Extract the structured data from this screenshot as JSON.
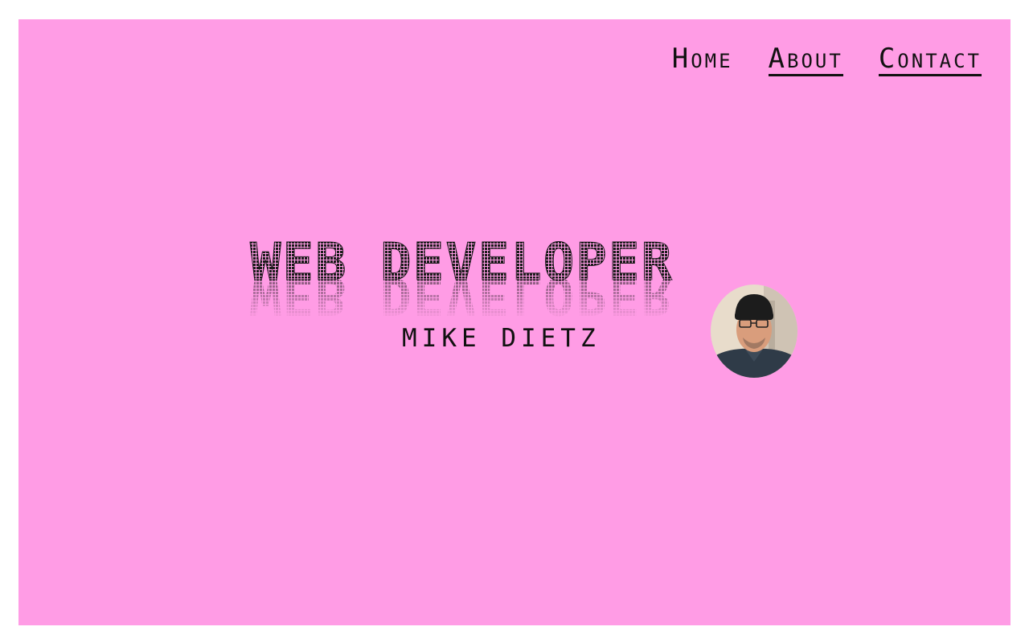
{
  "nav": {
    "items": [
      {
        "label": "Home",
        "underlined": false
      },
      {
        "label": "About",
        "underlined": true
      },
      {
        "label": "Contact",
        "underlined": true
      }
    ]
  },
  "hero": {
    "title": "WEB DEVELOPER",
    "name": "MIKE DIETZ"
  },
  "colors": {
    "background": "#ff9ce5",
    "text": "#111111"
  },
  "icons": {
    "avatar": "profile-photo"
  }
}
